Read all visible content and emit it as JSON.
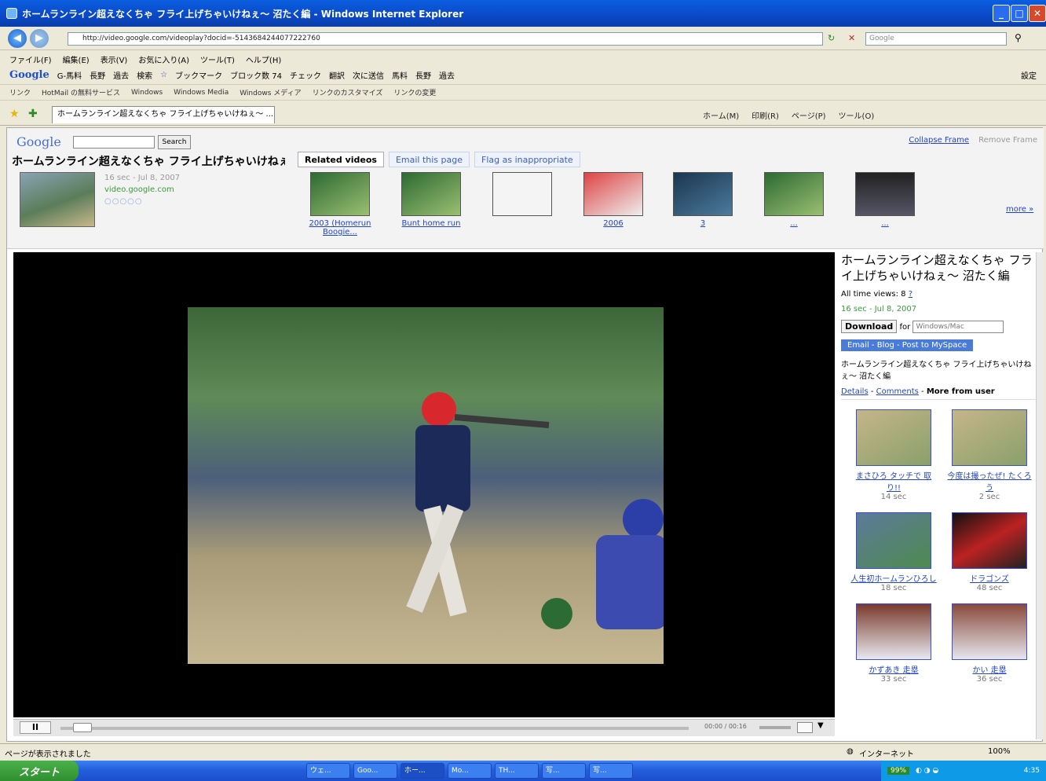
{
  "window": {
    "title": "ホームランライン超えなくちゃ フライ上げちゃいけねぇ〜 沼たく編 - Windows Internet Explorer"
  },
  "address": {
    "url": "http://video.google.com/videoplay?docid=-5143684244077222760",
    "search_placeholder": "Google"
  },
  "menu": [
    "ファイル(F)",
    "編集(E)",
    "表示(V)",
    "お気に入り(A)",
    "ツール(T)",
    "ヘルプ(H)"
  ],
  "google_toolbar": {
    "logo": "Google",
    "items": [
      "G-馬料",
      "長野",
      "過去",
      "検索",
      "ブックマーク",
      "ブロック数 74",
      "チェック",
      "翻訳",
      "次に送信",
      "馬料",
      "長野",
      "過去"
    ],
    "settings": "設定"
  },
  "links_bar": {
    "label": "リンク",
    "items": [
      "HotMail の無料サービス",
      "Windows",
      "Windows Media",
      "Windows メディア",
      "リンクのカスタマイズ",
      "リンクの変更"
    ]
  },
  "tab": {
    "label": "ホームランライン超えなくちゃ フライ上げちゃいけねぇ〜 ..."
  },
  "command_bar": [
    "ホーム(M)",
    "印刷(R)",
    "ページ(P)",
    "ツール(O)"
  ],
  "frame": {
    "logo": "Google",
    "search_button": "Search",
    "collapse": "Collapse Frame",
    "remove": "Remove Frame",
    "video_title": "ホームランライン超えなくちゃ フライ上げちゃいけねぇ",
    "duration_date": "16 sec - Jul 8, 2007",
    "source": "video.google.com",
    "tabs": [
      "Related videos",
      "Email this page",
      "Flag as inappropriate"
    ],
    "related": [
      "2003 (Homerun Boogie...",
      "Bunt home run",
      "",
      "2006",
      "3",
      "...",
      "..."
    ],
    "more": "more »"
  },
  "sidebar": {
    "title": "ホームランライン超えなくちゃ フライ上げちゃいけねぇ〜 沼たく編",
    "views_label": "All time views: 8",
    "date": "16 sec - Jul 8, 2007",
    "download": "Download",
    "for": "for",
    "platform": "Windows/Mac",
    "share": "Email - Blog - Post to MySpace",
    "description": "ホームランライン超えなくちゃ フライ上げちゃいけねぇ〜 沼たく編",
    "details": "Details",
    "comments": "Comments",
    "more_from_user": "More from user",
    "more_videos": [
      {
        "title": "まさひろ タッチで 取り!!",
        "duration": "14 sec"
      },
      {
        "title": "今度は撮ったぜ! たくろう",
        "duration": "2 sec"
      },
      {
        "title": "人生初ホームランひろし",
        "duration": "18 sec"
      },
      {
        "title": "ドラゴンズ",
        "duration": "48 sec"
      },
      {
        "title": "かずあき 走塁",
        "duration": "33 sec"
      },
      {
        "title": "かい 走塁",
        "duration": "36 sec"
      }
    ]
  },
  "player": {
    "time": "00:00 / 00:16",
    "pause": "II"
  },
  "status": {
    "text": "ページが表示されました",
    "zone": "インターネット",
    "zoom": "100%"
  },
  "taskbar": {
    "start": "スタート",
    "tasks": [
      "ウェ...",
      "Goo...",
      "ホー...",
      "Mo...",
      "TH...",
      "写...",
      "写..."
    ],
    "battery": "99%",
    "clock": "4:35"
  }
}
